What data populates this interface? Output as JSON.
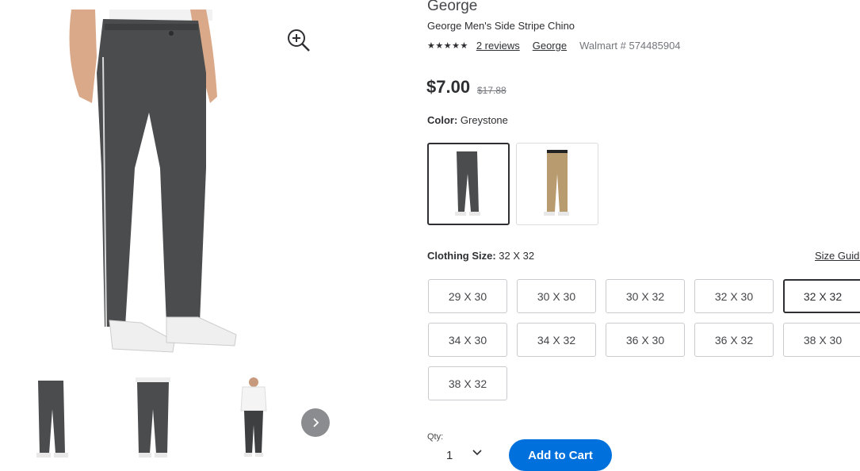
{
  "product": {
    "brand": "George",
    "title": "George Men's Side Stripe Chino",
    "stars": "★★★★★",
    "reviews_link": "2 reviews",
    "brand_link": "George",
    "walmart_number": "Walmart # 574485904",
    "price": "$7.00",
    "was_price": "$17.88"
  },
  "color": {
    "label": "Color:",
    "value": "Greystone",
    "swatches": [
      {
        "name": "Greystone",
        "hex": "#4a4b4d",
        "selected": true
      },
      {
        "name": "Khaki",
        "hex": "#b89b6e",
        "selected": false
      }
    ]
  },
  "size": {
    "label": "Clothing Size:",
    "value": "32 X 32",
    "guide_link": "Size Guide",
    "options": [
      "29 X 30",
      "30 X 30",
      "30 X 32",
      "32 X 30",
      "32 X 32",
      "34 X 30",
      "34 X 32",
      "36 X 30",
      "36 X 32",
      "38 X 30",
      "38 X 32"
    ],
    "selected": "32 X 32"
  },
  "quantity": {
    "label": "Qty:",
    "value": "1"
  },
  "cart": {
    "button_label": "Add to Cart"
  },
  "gallery": {
    "zoom_icon": "zoom-in-icon",
    "next_icon": "chevron-right-icon",
    "thumbnails": [
      "front-view",
      "back-view",
      "full-outfit-view"
    ]
  },
  "colors": {
    "accent": "#0071dc",
    "pants": "#4a4b4d",
    "khaki": "#b89b6e"
  }
}
